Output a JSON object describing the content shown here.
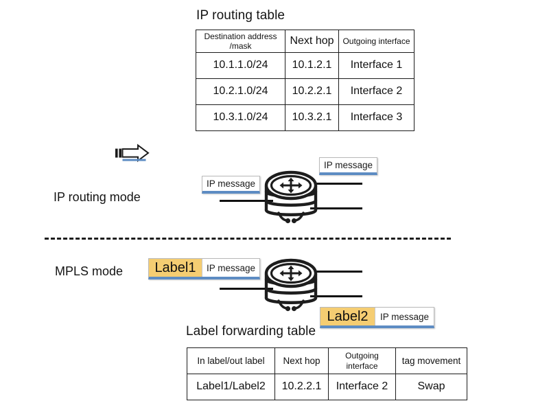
{
  "diagram": {
    "title_ip_routing_table": "IP routing table",
    "title_label_forwarding_table": "Label forwarding table",
    "mode_ip": "IP routing mode",
    "mode_mpls": "MPLS mode",
    "icons": {
      "router": "router-icon",
      "cursor_arrow": "right-arrow-pointer-icon"
    },
    "colors": {
      "label_fill": "#f5cd72",
      "packet_accent": "#5d8cc3",
      "line": "#101010",
      "table_border": "#1b1b1b"
    }
  },
  "ip_routing_table": {
    "headers": [
      "Destination address\n/mask",
      "Next hop",
      "Outgoing interface"
    ],
    "header_line1": "Destination address",
    "header_line2": "/mask",
    "header_next_hop": "Next hop",
    "header_outgoing": "Outgoing interface",
    "rows": [
      {
        "destination": "10.1.1.0/24",
        "next_hop": "10.1.2.1",
        "interface": "Interface 1"
      },
      {
        "destination": "10.2.1.0/24",
        "next_hop": "10.2.2.1",
        "interface": "Interface 2"
      },
      {
        "destination": "10.3.1.0/24",
        "next_hop": "10.3.2.1",
        "interface": "Interface 3"
      }
    ]
  },
  "label_forwarding_table": {
    "header_in_out": "In label/out label",
    "header_next_hop": "Next hop",
    "header_outgoing": "Outgoing interface",
    "header_tag_movement": "tag movement",
    "rows": [
      {
        "in_out": "Label1/Label2",
        "next_hop": "10.2.2.1",
        "interface": "Interface 2",
        "tag_movement": "Swap"
      }
    ]
  },
  "ip_section": {
    "packet_in_text": "IP message",
    "packet_out_text": "IP message"
  },
  "mpls_section": {
    "packet_in_label": "Label1",
    "packet_in_text": "IP message",
    "packet_out_label": "Label2",
    "packet_out_text": "IP message"
  }
}
